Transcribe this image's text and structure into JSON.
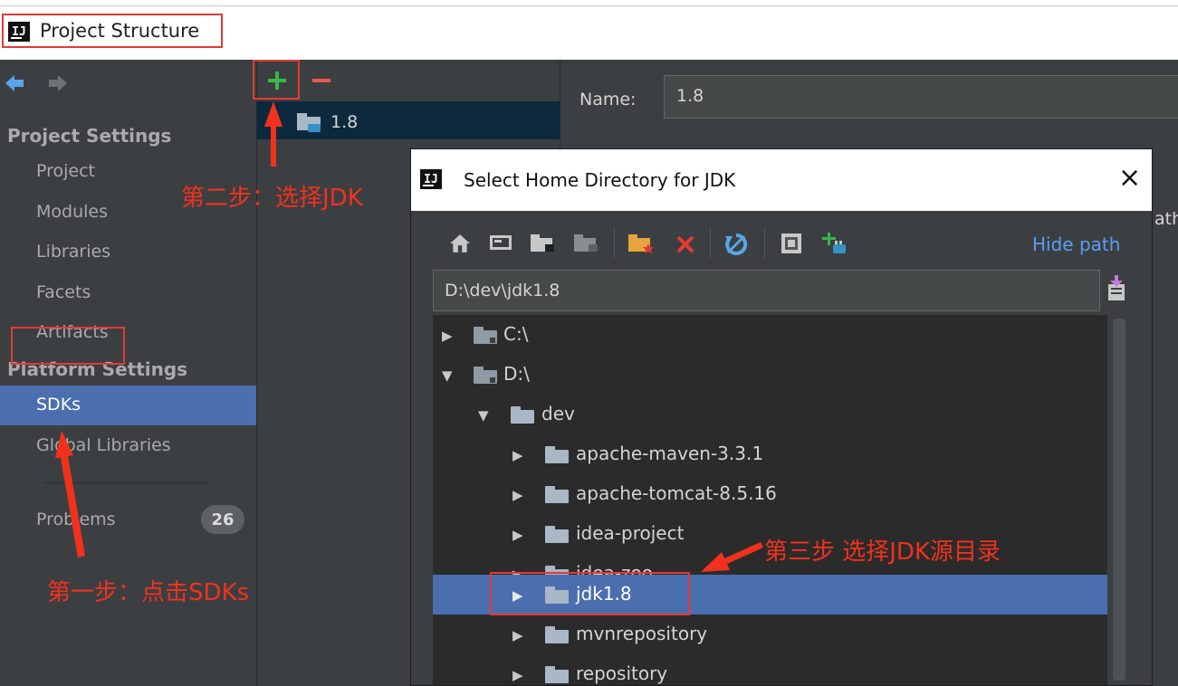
{
  "window": {
    "title": "Project Structure",
    "logo_text": "IJ"
  },
  "sidebar": {
    "section_project": "Project Settings",
    "project_items": [
      "Project",
      "Modules",
      "Libraries",
      "Facets",
      "Artifacts"
    ],
    "section_platform": "Platform Settings",
    "platform_items": [
      "SDKs",
      "Global Libraries"
    ],
    "problems_label": "Problems",
    "problems_count": "26"
  },
  "middle": {
    "add_icon": "plus-icon",
    "remove_icon": "minus-icon",
    "sdk_item": "1.8"
  },
  "right": {
    "name_label": "Name:",
    "name_value": "1.8",
    "partial_text": "ath"
  },
  "dialog": {
    "logo_text": "IJ",
    "title": "Select Home Directory for JDK",
    "close": "×",
    "hide_path": "Hide path",
    "path_value": "D:\\dev\\jdk1.8",
    "toolbar_icons": [
      "home-icon",
      "desktop-icon",
      "project-folder-icon",
      "module-folder-icon",
      "new-folder-icon",
      "delete-icon",
      "refresh-icon",
      "show-hidden-icon",
      "new-jdk-icon"
    ],
    "tree": [
      {
        "label": "C:\\",
        "expanded": false,
        "level": 0,
        "kind": "drive"
      },
      {
        "label": "D:\\",
        "expanded": true,
        "level": 0,
        "kind": "drive"
      },
      {
        "label": "dev",
        "expanded": true,
        "level": 1,
        "kind": "folder"
      },
      {
        "label": "apache-maven-3.3.1",
        "expanded": false,
        "level": 2,
        "kind": "folder"
      },
      {
        "label": "apache-tomcat-8.5.16",
        "expanded": false,
        "level": 2,
        "kind": "folder"
      },
      {
        "label": "idea-project",
        "expanded": false,
        "level": 2,
        "kind": "folder"
      },
      {
        "label": "idea-zoo",
        "expanded": false,
        "level": 2,
        "kind": "folder"
      },
      {
        "label": "jdk1.8",
        "expanded": false,
        "level": 2,
        "kind": "folder",
        "selected": true
      },
      {
        "label": "mvnrepository",
        "expanded": false,
        "level": 2,
        "kind": "folder"
      },
      {
        "label": "repository",
        "expanded": false,
        "level": 2,
        "kind": "folder"
      }
    ]
  },
  "annotations": {
    "step1": "第一步：点击SDKs",
    "step2": "第二步：选择JDK",
    "step3": "第三步 选择JDK源目录",
    "color": "#f2311d"
  },
  "colors": {
    "selection": "#4b6eaf",
    "panel": "#3c3f41",
    "link": "#589df6",
    "plus": "#3bb54a",
    "minus": "#e85a4f"
  }
}
